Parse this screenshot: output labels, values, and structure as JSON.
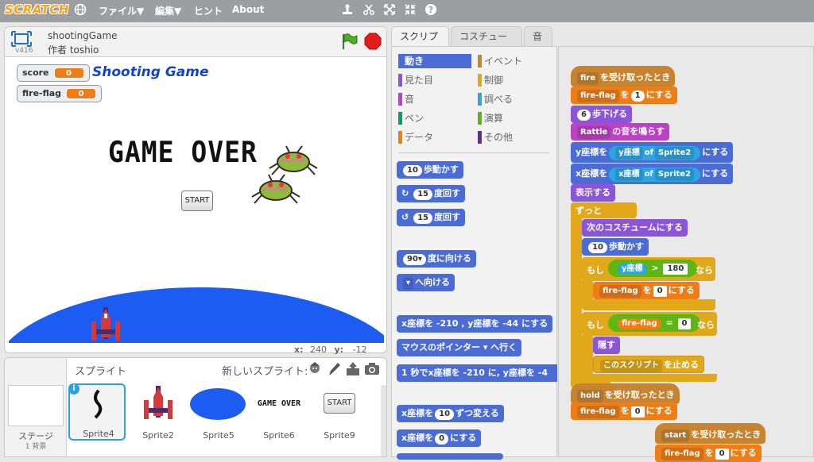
{
  "topbar": {
    "logo": "SCRATCH",
    "menus": [
      "ファイル▼",
      "編集▼",
      "ヒント",
      "About"
    ]
  },
  "stage_header": {
    "version": "v416",
    "project_title": "shootingGame",
    "author": "作者 toshio"
  },
  "stage": {
    "monitors": [
      {
        "label": "score",
        "value": "0"
      },
      {
        "label": "fire-flag",
        "value": "0"
      }
    ],
    "title_text": "Shooting Game",
    "game_over_text": "GAME OVER",
    "start_button": "START"
  },
  "coords": {
    "x_label": "x:",
    "x": "240",
    "y_label": "y:",
    "y": "-12"
  },
  "sprites_panel": {
    "title": "スプライト",
    "new_sprite": "新しいスプライト:",
    "stage_label": "ステージ",
    "stage_sub": "1 背景",
    "sprites": [
      {
        "name": "Sprite4",
        "selected": true
      },
      {
        "name": "Sprite2"
      },
      {
        "name": "Sprite5"
      },
      {
        "name": "Sprite6",
        "thumb_text": "GAME OVER"
      },
      {
        "name": "Sprite9",
        "thumb_text": "START"
      }
    ]
  },
  "tabs": [
    "スクリプト",
    "コスチューム",
    "音"
  ],
  "categories": [
    {
      "label": "動き",
      "color": "#4a6cd4",
      "active": true
    },
    {
      "label": "イベント",
      "color": "#c88330"
    },
    {
      "label": "見た目",
      "color": "#8a55d7"
    },
    {
      "label": "制御",
      "color": "#e1a91a"
    },
    {
      "label": "音",
      "color": "#bb42c3"
    },
    {
      "label": "調べる",
      "color": "#2ca5e2"
    },
    {
      "label": "ペン",
      "color": "#0e9a6c"
    },
    {
      "label": "演算",
      "color": "#5cb712"
    },
    {
      "label": "データ",
      "color": "#ee7d16"
    },
    {
      "label": "その他",
      "color": "#632d99"
    }
  ],
  "palette_blocks": [
    {
      "text": "歩動かす",
      "num": "10"
    },
    {
      "text": "度回す",
      "num": "15",
      "icon": "↻"
    },
    {
      "text": "度回す",
      "num": "15",
      "icon": "↺"
    },
    {
      "text": "度に向ける",
      "num": "90▾"
    },
    {
      "text": "へ向ける",
      "num": "▾"
    },
    {
      "text": "x座標を -210 , y座標を -44 にする"
    },
    {
      "text": "マウスのポインター ▾ へ行く"
    },
    {
      "text": "1 秒でx座標を -210 に, y座標を -4"
    },
    {
      "text": "ずつ変える",
      "pre": "x座標を",
      "num": "10"
    },
    {
      "text": "にする",
      "pre": "x座標を",
      "num": "0"
    }
  ],
  "scripts": {
    "hat1": {
      "var": "fire",
      "text": "を受け取ったとき"
    },
    "b1": {
      "var": "fire-flag",
      "mid": "を",
      "val": "1",
      "text": "にする"
    },
    "b2": {
      "val": "6",
      "text": "歩下げる"
    },
    "b3": {
      "var": "Rattle",
      "text": "の音を鳴らす"
    },
    "b4": {
      "pre": "y座標を",
      "a": "y座標",
      "of": "of",
      "b": "Sprite2",
      "text": "にする"
    },
    "b5": {
      "pre": "x座標を",
      "a": "x座標",
      "of": "of",
      "b": "Sprite2",
      "text": "にする"
    },
    "b6": {
      "text": "表示する"
    },
    "forever": "ずっと",
    "b7": {
      "text": "次のコスチュームにする"
    },
    "b8": {
      "val": "10",
      "text": "歩動かす"
    },
    "if1": {
      "pre": "もし",
      "a": "y座標",
      "op": ">",
      "b": "180",
      "text": "なら"
    },
    "b9": {
      "var": "fire-flag",
      "mid": "を",
      "val": "0",
      "text": "にする"
    },
    "if2": {
      "pre": "もし",
      "a": "fire-flag",
      "op": "=",
      "b": "0",
      "text": "なら"
    },
    "b10": {
      "text": "隠す"
    },
    "b11": {
      "var": "このスクリプト",
      "text": "を止める"
    },
    "hat2": {
      "var": "hold",
      "text": "を受け取ったとき"
    },
    "b12": {
      "var": "fire-flag",
      "mid": "を",
      "val": "0",
      "text": "にする"
    },
    "hat3": {
      "var": "start",
      "text": "を受け取ったとき"
    },
    "b13": {
      "var": "fire-flag",
      "mid": "を",
      "val": "0",
      "text": "にする"
    }
  }
}
